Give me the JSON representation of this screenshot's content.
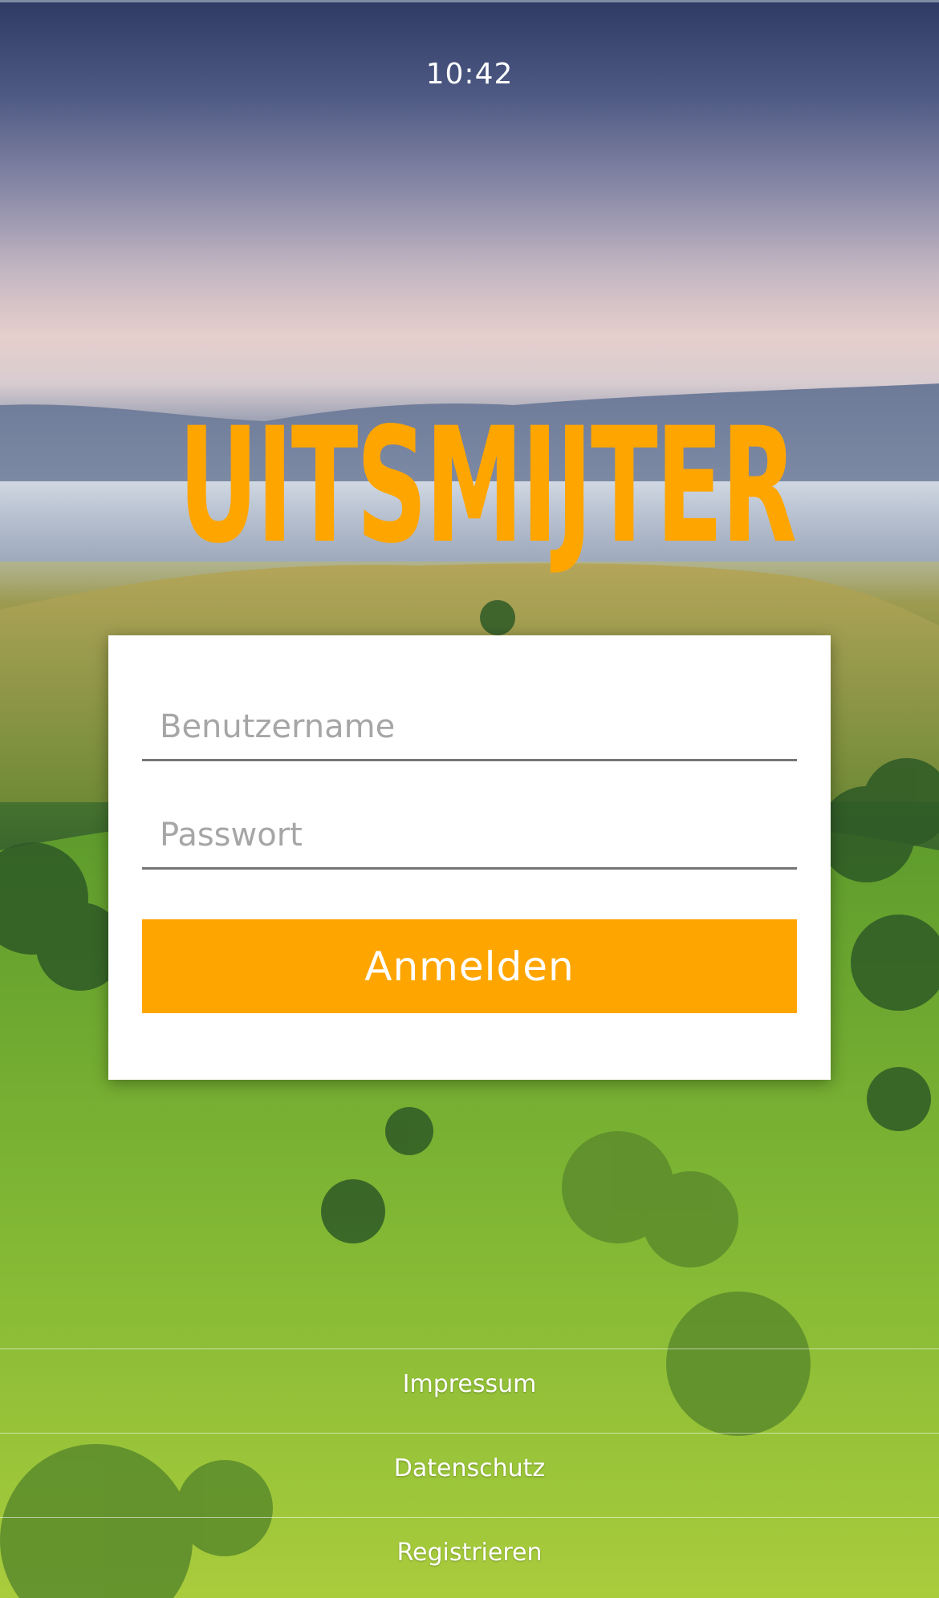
{
  "status_bar": {
    "time": "10:42"
  },
  "brand": {
    "logo_text": "UITSMIJTER",
    "logo_color": "#ffa500",
    "accent_mark_color": "#d11f1f"
  },
  "login_form": {
    "username": {
      "placeholder": "Benutzername",
      "value": ""
    },
    "password": {
      "placeholder": "Passwort",
      "value": ""
    },
    "submit_label": "Anmelden",
    "button_color": "#ffa500"
  },
  "footer": {
    "links": [
      {
        "label": "Impressum"
      },
      {
        "label": "Datenschutz"
      },
      {
        "label": "Registrieren"
      }
    ]
  }
}
